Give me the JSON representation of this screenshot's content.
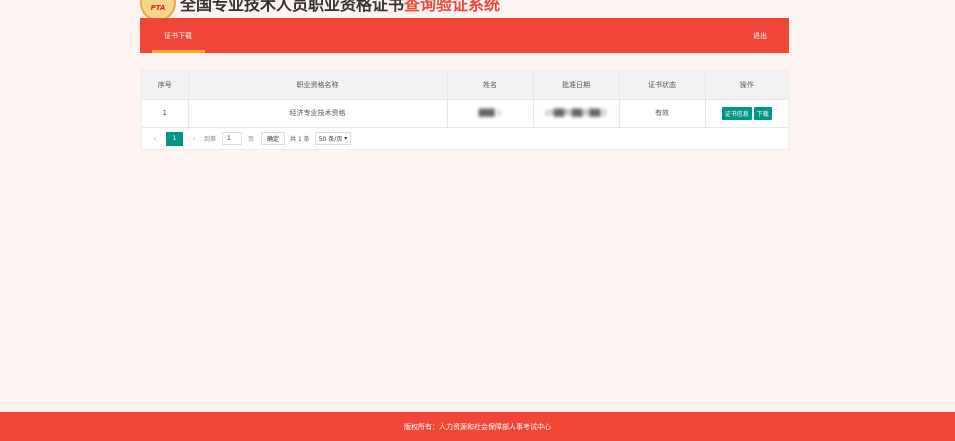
{
  "header": {
    "logo_text": "PTA",
    "title_main": "全国专业技术人员职业资格证书",
    "title_accent": "查询验证系统"
  },
  "nav": {
    "tab_label": "证书下载",
    "logout_label": "退出"
  },
  "table": {
    "headers": [
      "序号",
      "职业资格名称",
      "姓名",
      "批准日期",
      "证书状态",
      "操作"
    ],
    "rows": [
      {
        "index": "1",
        "qualification": "经济专业技术资格",
        "name": "███ 1",
        "date": "20██年██月██日",
        "status": "有效",
        "action_info": "证书信息",
        "action_download": "下载"
      }
    ]
  },
  "pager": {
    "prev": "‹",
    "next": "›",
    "current_page": "1",
    "goto_prefix": "到第",
    "goto_value": "1",
    "goto_suffix": "页",
    "confirm": "确定",
    "total": "共 1 条",
    "page_size": "50 条/页"
  },
  "footer": {
    "text": "版权所有：人力资源和社会保障部人事考试中心"
  },
  "colors": {
    "brand_red": "#f04637",
    "accent_orange": "#f9a825",
    "button_teal": "#009688",
    "background": "#fdf4f1"
  }
}
